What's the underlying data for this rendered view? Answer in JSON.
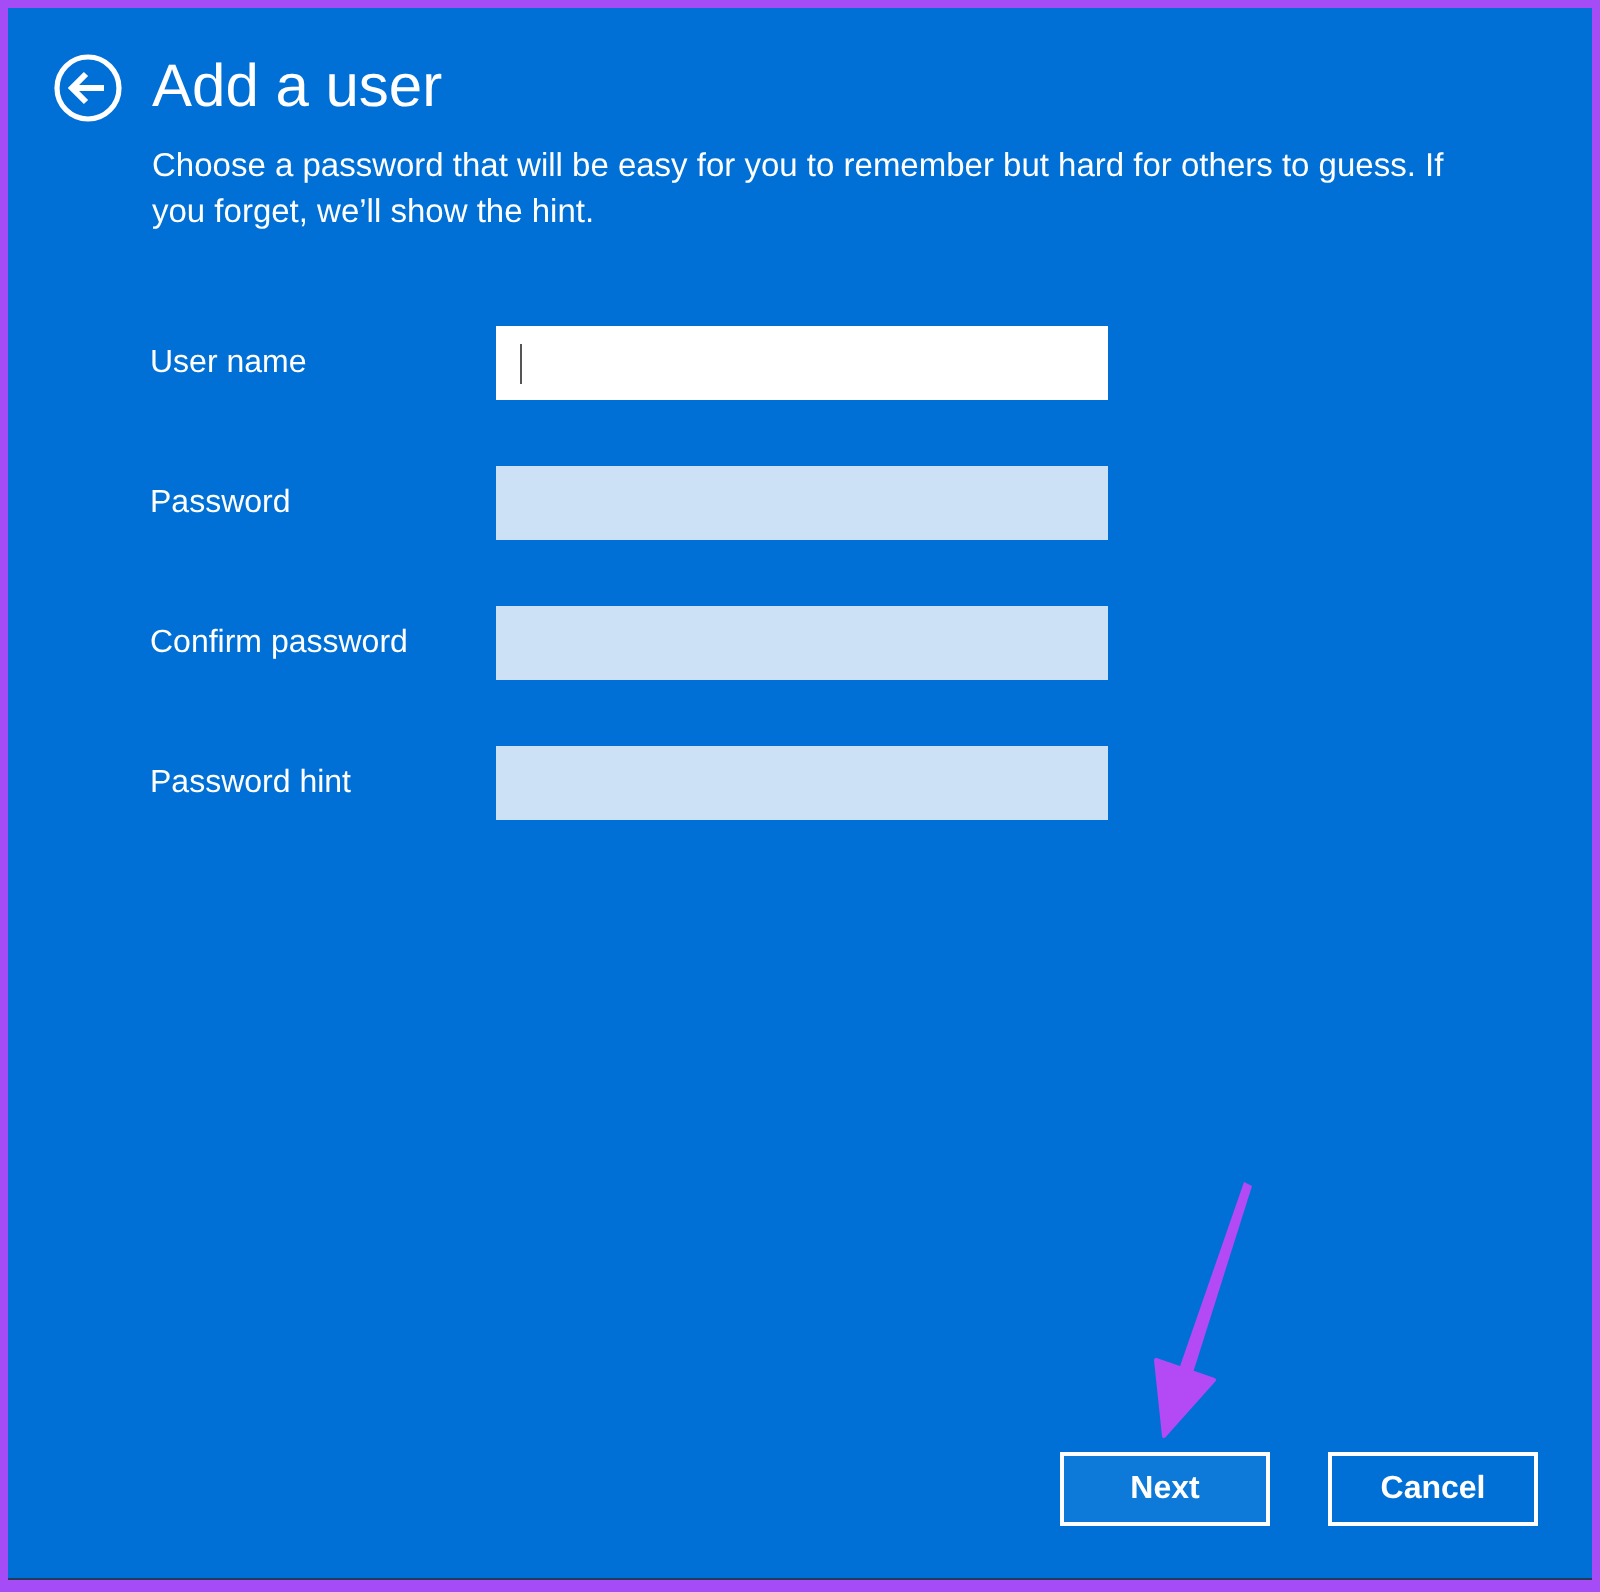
{
  "page": {
    "title": "Add a user",
    "description": "Choose a password that will be easy for you to remember but hard for others to guess. If you forget, we’ll show the hint."
  },
  "fields": [
    {
      "label": "User name",
      "focused": true
    },
    {
      "label": "Password",
      "focused": false
    },
    {
      "label": "Confirm password",
      "focused": false
    },
    {
      "label": "Password hint",
      "focused": false
    }
  ],
  "buttons": [
    {
      "label": "Next",
      "default": true
    },
    {
      "label": "Cancel",
      "default": false
    }
  ],
  "annotation": {
    "kind": "arrow"
  }
}
